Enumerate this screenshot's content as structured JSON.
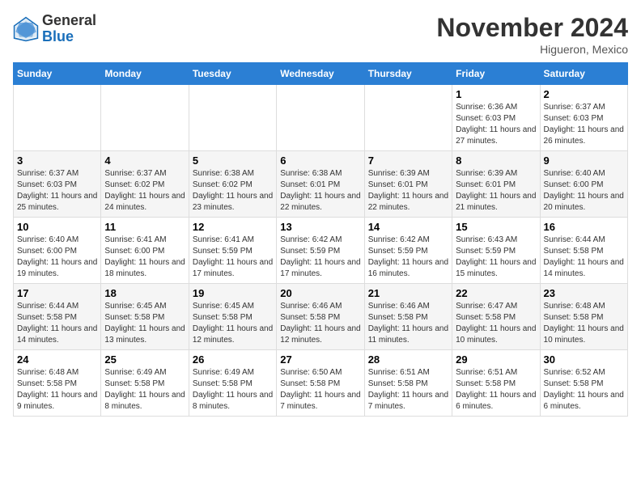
{
  "header": {
    "logo_general": "General",
    "logo_blue": "Blue",
    "month_title": "November 2024",
    "location": "Higueron, Mexico"
  },
  "days_of_week": [
    "Sunday",
    "Monday",
    "Tuesday",
    "Wednesday",
    "Thursday",
    "Friday",
    "Saturday"
  ],
  "weeks": [
    [
      {
        "day": "",
        "info": ""
      },
      {
        "day": "",
        "info": ""
      },
      {
        "day": "",
        "info": ""
      },
      {
        "day": "",
        "info": ""
      },
      {
        "day": "",
        "info": ""
      },
      {
        "day": "1",
        "info": "Sunrise: 6:36 AM\nSunset: 6:03 PM\nDaylight: 11 hours and 27 minutes."
      },
      {
        "day": "2",
        "info": "Sunrise: 6:37 AM\nSunset: 6:03 PM\nDaylight: 11 hours and 26 minutes."
      }
    ],
    [
      {
        "day": "3",
        "info": "Sunrise: 6:37 AM\nSunset: 6:03 PM\nDaylight: 11 hours and 25 minutes."
      },
      {
        "day": "4",
        "info": "Sunrise: 6:37 AM\nSunset: 6:02 PM\nDaylight: 11 hours and 24 minutes."
      },
      {
        "day": "5",
        "info": "Sunrise: 6:38 AM\nSunset: 6:02 PM\nDaylight: 11 hours and 23 minutes."
      },
      {
        "day": "6",
        "info": "Sunrise: 6:38 AM\nSunset: 6:01 PM\nDaylight: 11 hours and 22 minutes."
      },
      {
        "day": "7",
        "info": "Sunrise: 6:39 AM\nSunset: 6:01 PM\nDaylight: 11 hours and 22 minutes."
      },
      {
        "day": "8",
        "info": "Sunrise: 6:39 AM\nSunset: 6:01 PM\nDaylight: 11 hours and 21 minutes."
      },
      {
        "day": "9",
        "info": "Sunrise: 6:40 AM\nSunset: 6:00 PM\nDaylight: 11 hours and 20 minutes."
      }
    ],
    [
      {
        "day": "10",
        "info": "Sunrise: 6:40 AM\nSunset: 6:00 PM\nDaylight: 11 hours and 19 minutes."
      },
      {
        "day": "11",
        "info": "Sunrise: 6:41 AM\nSunset: 6:00 PM\nDaylight: 11 hours and 18 minutes."
      },
      {
        "day": "12",
        "info": "Sunrise: 6:41 AM\nSunset: 5:59 PM\nDaylight: 11 hours and 17 minutes."
      },
      {
        "day": "13",
        "info": "Sunrise: 6:42 AM\nSunset: 5:59 PM\nDaylight: 11 hours and 17 minutes."
      },
      {
        "day": "14",
        "info": "Sunrise: 6:42 AM\nSunset: 5:59 PM\nDaylight: 11 hours and 16 minutes."
      },
      {
        "day": "15",
        "info": "Sunrise: 6:43 AM\nSunset: 5:59 PM\nDaylight: 11 hours and 15 minutes."
      },
      {
        "day": "16",
        "info": "Sunrise: 6:44 AM\nSunset: 5:58 PM\nDaylight: 11 hours and 14 minutes."
      }
    ],
    [
      {
        "day": "17",
        "info": "Sunrise: 6:44 AM\nSunset: 5:58 PM\nDaylight: 11 hours and 14 minutes."
      },
      {
        "day": "18",
        "info": "Sunrise: 6:45 AM\nSunset: 5:58 PM\nDaylight: 11 hours and 13 minutes."
      },
      {
        "day": "19",
        "info": "Sunrise: 6:45 AM\nSunset: 5:58 PM\nDaylight: 11 hours and 12 minutes."
      },
      {
        "day": "20",
        "info": "Sunrise: 6:46 AM\nSunset: 5:58 PM\nDaylight: 11 hours and 12 minutes."
      },
      {
        "day": "21",
        "info": "Sunrise: 6:46 AM\nSunset: 5:58 PM\nDaylight: 11 hours and 11 minutes."
      },
      {
        "day": "22",
        "info": "Sunrise: 6:47 AM\nSunset: 5:58 PM\nDaylight: 11 hours and 10 minutes."
      },
      {
        "day": "23",
        "info": "Sunrise: 6:48 AM\nSunset: 5:58 PM\nDaylight: 11 hours and 10 minutes."
      }
    ],
    [
      {
        "day": "24",
        "info": "Sunrise: 6:48 AM\nSunset: 5:58 PM\nDaylight: 11 hours and 9 minutes."
      },
      {
        "day": "25",
        "info": "Sunrise: 6:49 AM\nSunset: 5:58 PM\nDaylight: 11 hours and 8 minutes."
      },
      {
        "day": "26",
        "info": "Sunrise: 6:49 AM\nSunset: 5:58 PM\nDaylight: 11 hours and 8 minutes."
      },
      {
        "day": "27",
        "info": "Sunrise: 6:50 AM\nSunset: 5:58 PM\nDaylight: 11 hours and 7 minutes."
      },
      {
        "day": "28",
        "info": "Sunrise: 6:51 AM\nSunset: 5:58 PM\nDaylight: 11 hours and 7 minutes."
      },
      {
        "day": "29",
        "info": "Sunrise: 6:51 AM\nSunset: 5:58 PM\nDaylight: 11 hours and 6 minutes."
      },
      {
        "day": "30",
        "info": "Sunrise: 6:52 AM\nSunset: 5:58 PM\nDaylight: 11 hours and 6 minutes."
      }
    ]
  ]
}
